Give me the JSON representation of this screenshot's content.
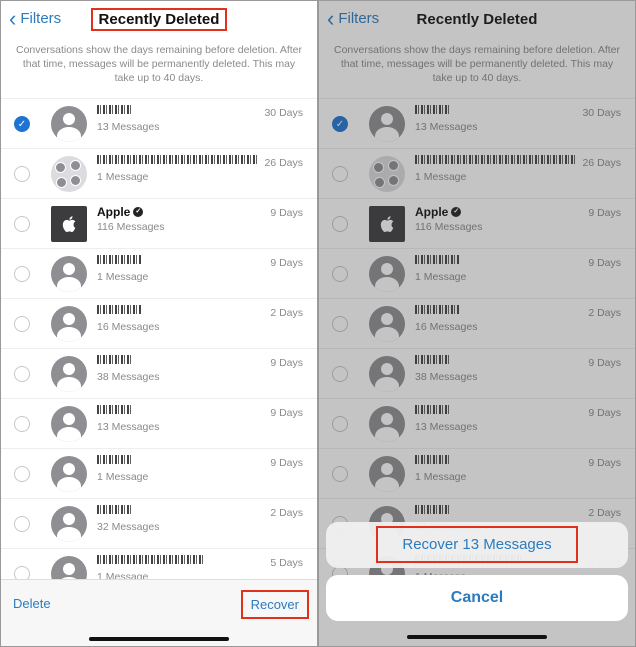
{
  "header": {
    "back_label": "Filters",
    "title": "Recently Deleted"
  },
  "note": "Conversations show the days remaining before deletion. After that time, messages will be permanently deleted. This may take up to 40 days.",
  "conversations": [
    {
      "avatar": "person",
      "name": "",
      "count": "13 Messages",
      "days": "30 Days",
      "selected": true
    },
    {
      "avatar": "group",
      "name": "",
      "count": "1 Message",
      "days": "26 Days",
      "selected": false
    },
    {
      "avatar": "apple",
      "name": "Apple",
      "verified": true,
      "count": "116 Messages",
      "days": "9 Days",
      "selected": false
    },
    {
      "avatar": "person",
      "name": "",
      "count": "1 Message",
      "days": "9 Days",
      "selected": false
    },
    {
      "avatar": "person",
      "name": "",
      "count": "16 Messages",
      "days": "2 Days",
      "selected": false
    },
    {
      "avatar": "person",
      "name": "",
      "count": "38 Messages",
      "days": "9 Days",
      "selected": false
    },
    {
      "avatar": "person",
      "name": "",
      "count": "13 Messages",
      "days": "9 Days",
      "selected": false
    },
    {
      "avatar": "person",
      "name": "",
      "count": "1 Message",
      "days": "9 Days",
      "selected": false
    },
    {
      "avatar": "person",
      "name": "",
      "count": "32 Messages",
      "days": "2 Days",
      "selected": false
    },
    {
      "avatar": "person",
      "name": "",
      "count": "1 Message",
      "days": "5 Days",
      "selected": false
    }
  ],
  "toolbar": {
    "delete_label": "Delete",
    "recover_label": "Recover"
  },
  "action_sheet": {
    "recover_label": "Recover 13 Messages",
    "cancel_label": "Cancel"
  },
  "colors": {
    "accent": "#2b7bbf",
    "highlight": "#e0301e",
    "selected": "#1f74d3"
  }
}
